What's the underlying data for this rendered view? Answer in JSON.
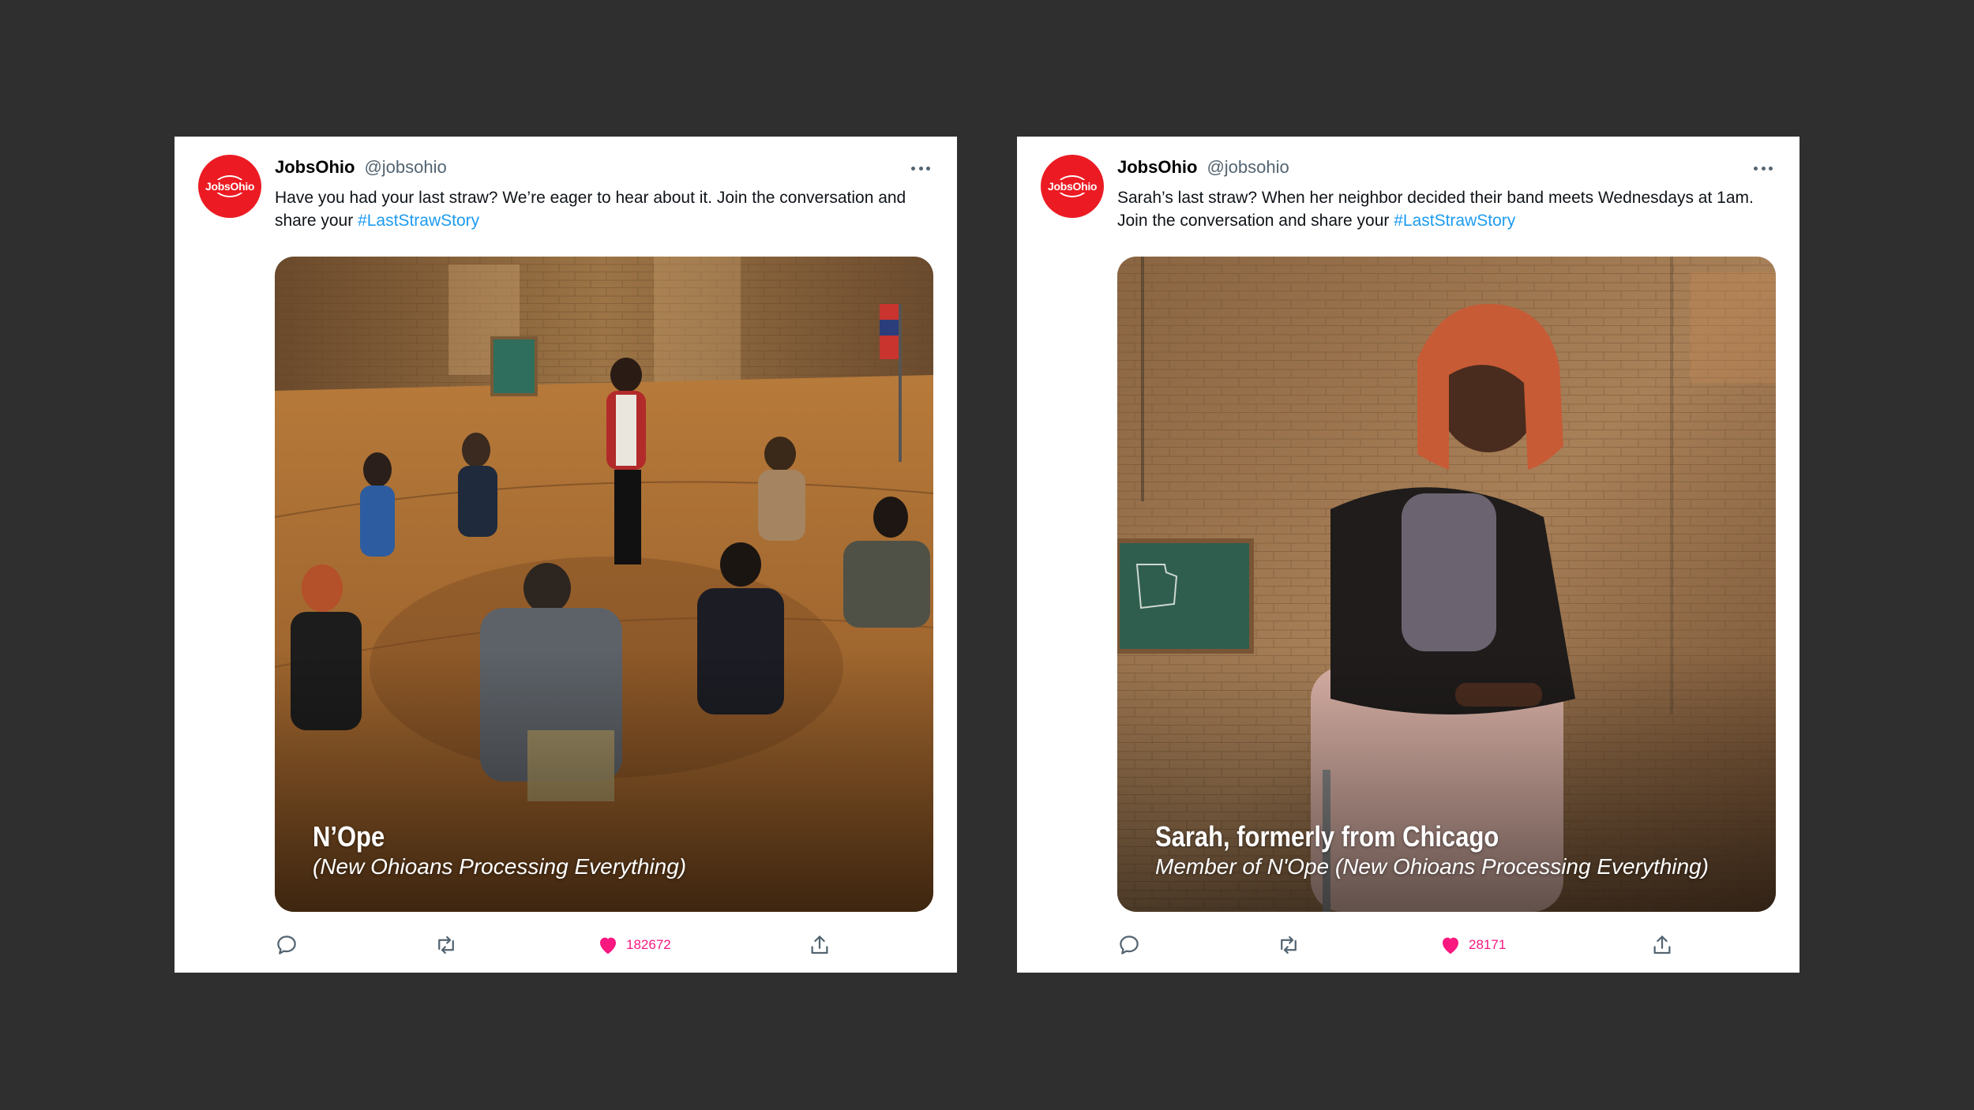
{
  "colors": {
    "background": "#2f2f2f",
    "card": "#ffffff",
    "brand_red": "#ec1b23",
    "hashtag_blue": "#1d9bf0",
    "like_pink": "#f91880",
    "icon_gray": "#536471"
  },
  "tweets": [
    {
      "avatar_text": "JobsOhio",
      "author_name": "JobsOhio",
      "author_handle": "@jobsohio",
      "text": "Have you had your last straw? We’re eager to hear about it. Join the conversation and share your ",
      "hashtag": "#LastStrawStory",
      "media": {
        "caption_title": "N’Ope",
        "caption_subtitle": "(New Ohioans Processing Everything)"
      },
      "actions": {
        "reply_icon": "reply-icon",
        "retweet_icon": "retweet-icon",
        "like_icon": "heart-icon",
        "like_count": "182672",
        "share_icon": "share-icon"
      }
    },
    {
      "avatar_text": "JobsOhio",
      "author_name": "JobsOhio",
      "author_handle": "@jobsohio",
      "text": "Sarah’s last straw? When her neighbor decided their band meets Wednesdays at 1am. Join the conversation and share your ",
      "hashtag": "#LastStrawStory",
      "media": {
        "caption_title": "Sarah, formerly from Chicago",
        "caption_subtitle": "Member of N'Ope (New Ohioans Processing Everything)"
      },
      "actions": {
        "reply_icon": "reply-icon",
        "retweet_icon": "retweet-icon",
        "like_icon": "heart-icon",
        "like_count": "28171",
        "share_icon": "share-icon"
      }
    }
  ]
}
